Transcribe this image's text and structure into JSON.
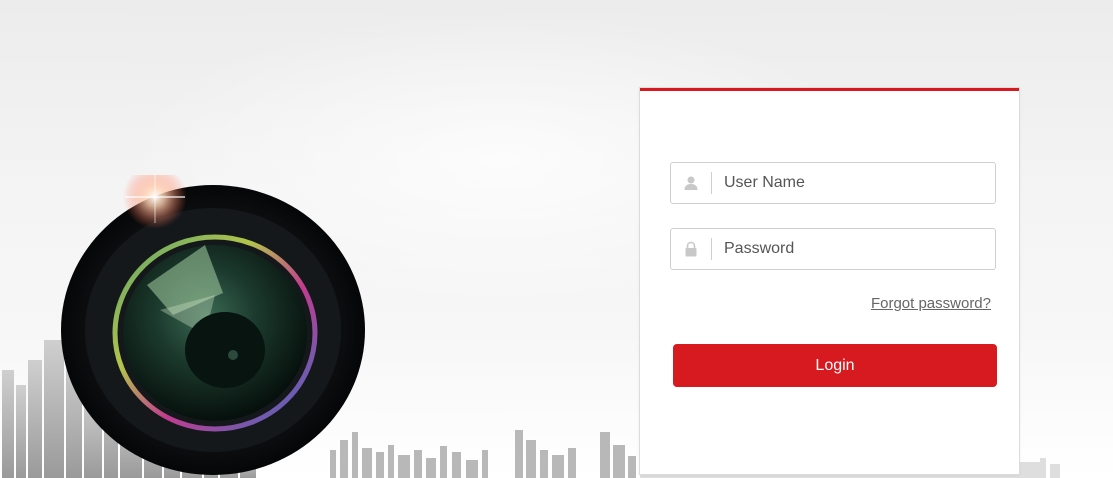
{
  "colors": {
    "accent": "#d71920",
    "field_border": "#cfcfcf",
    "link": "#666666"
  },
  "login": {
    "username": {
      "icon": "user-icon",
      "placeholder": "User Name",
      "value": ""
    },
    "password": {
      "icon": "lock-icon",
      "placeholder": "Password",
      "value": ""
    },
    "forgot_label": "Forgot password?",
    "submit_label": "Login"
  }
}
